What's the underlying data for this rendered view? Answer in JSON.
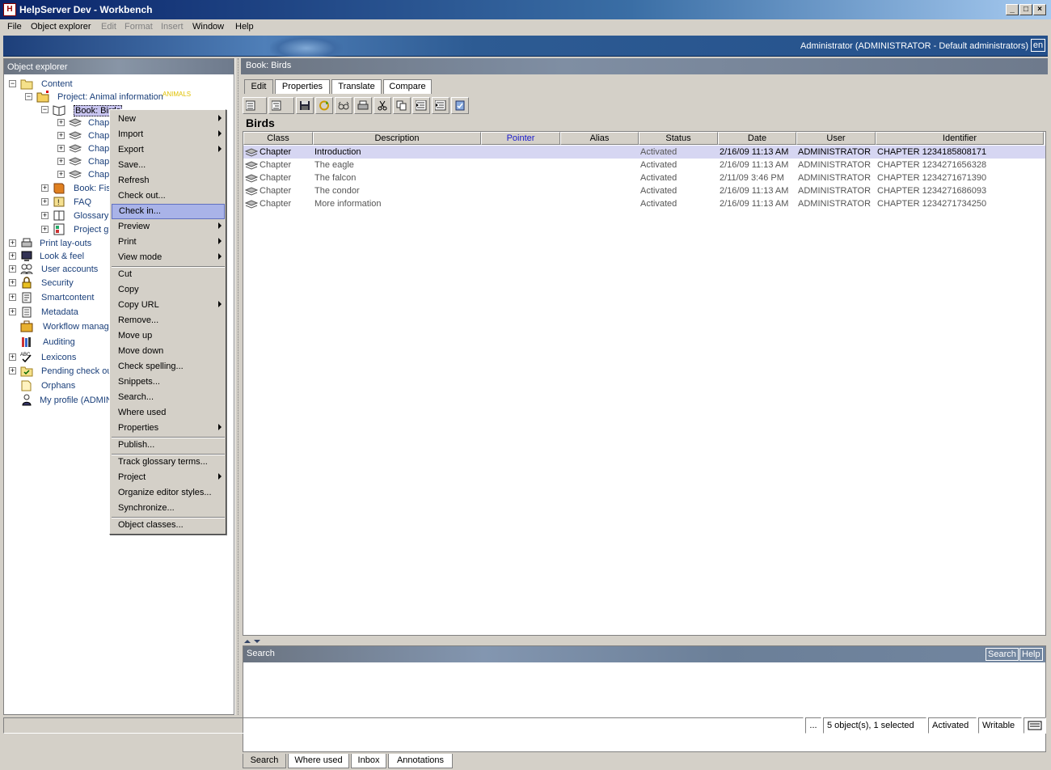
{
  "window": {
    "title": "HelpServer Dev - Workbench",
    "app_icon": "H"
  },
  "menubar": {
    "items": [
      {
        "label": "File",
        "enabled": true
      },
      {
        "label": "Object explorer",
        "enabled": true
      },
      {
        "label": "Edit",
        "enabled": false
      },
      {
        "label": "Format",
        "enabled": false
      },
      {
        "label": "Insert",
        "enabled": false
      },
      {
        "label": "Window",
        "enabled": true
      },
      {
        "label": "Help",
        "enabled": true
      }
    ]
  },
  "banner": {
    "user": "Administrator (ADMINISTRATOR - Default administrators)",
    "language": "en"
  },
  "explorer": {
    "title": "Object explorer",
    "tree": {
      "content": "Content",
      "project": "Project: Animal information",
      "project_tag": "ANIMALS",
      "book": "Book: Birds",
      "chapters": [
        "Chap",
        "Chap",
        "Chap",
        "Chap",
        "Chap"
      ],
      "book_fish": "Book: Fis",
      "faq": "FAQ",
      "glossary": "Glossary",
      "project_gl": "Project gl",
      "print_layouts": "Print lay-outs",
      "look_feel": "Look & feel",
      "user_accounts": "User accounts",
      "security": "Security",
      "smartcontent": "Smartcontent",
      "metadata": "Metadata",
      "workflow": "Workflow manag",
      "auditing": "Auditing",
      "lexicons": "Lexicons",
      "pending": "Pending check ou",
      "orphans": "Orphans",
      "my_profile": "My profile (ADMIN"
    }
  },
  "context_menu": {
    "items": [
      {
        "label": "New",
        "submenu": true
      },
      {
        "label": "Import",
        "submenu": true
      },
      {
        "label": "Export",
        "submenu": true
      },
      {
        "label": "Save...",
        "submenu": false
      },
      {
        "label": "Refresh",
        "submenu": false
      },
      {
        "label": "Check out...",
        "submenu": false
      },
      {
        "label": "Check in...",
        "submenu": false,
        "highlighted": true
      },
      {
        "label": "Preview",
        "submenu": true
      },
      {
        "label": "Print",
        "submenu": true
      },
      {
        "label": "View mode",
        "submenu": true
      },
      {
        "label": "Cut",
        "submenu": false
      },
      {
        "label": "Copy",
        "submenu": false
      },
      {
        "label": "Copy URL",
        "submenu": true
      },
      {
        "label": "Remove...",
        "submenu": false
      },
      {
        "label": "Move up",
        "submenu": false
      },
      {
        "label": "Move down",
        "submenu": false
      },
      {
        "label": "Check spelling...",
        "submenu": false
      },
      {
        "label": "Snippets...",
        "submenu": false
      },
      {
        "label": "Search...",
        "submenu": false
      },
      {
        "label": "Where used",
        "submenu": false
      },
      {
        "label": "Properties",
        "submenu": true
      },
      {
        "label": "Publish...",
        "submenu": false
      },
      {
        "label": "Track glossary terms...",
        "submenu": false
      },
      {
        "label": "Project",
        "submenu": true
      },
      {
        "label": "Organize editor styles...",
        "submenu": false
      },
      {
        "label": "Synchronize...",
        "submenu": false
      },
      {
        "label": "Object classes...",
        "submenu": false
      }
    ]
  },
  "main": {
    "header": "Book: Birds",
    "tabs": [
      "Edit",
      "Properties",
      "Translate",
      "Compare"
    ],
    "active_tab": "Edit",
    "doc_title": "Birds",
    "columns": [
      "Class",
      "Description",
      "Pointer",
      "Alias",
      "Status",
      "Date",
      "User",
      "Identifier"
    ],
    "rows": [
      {
        "class": "Chapter",
        "description": "Introduction",
        "pointer": "",
        "alias": "",
        "status": "Activated",
        "date": "2/16/09 11:13 AM",
        "user": "ADMINISTRATOR",
        "identifier": "CHAPTER 1234185808171",
        "selected": true
      },
      {
        "class": "Chapter",
        "description": "The eagle",
        "pointer": "",
        "alias": "",
        "status": "Activated",
        "date": "2/16/09 11:13 AM",
        "user": "ADMINISTRATOR",
        "identifier": "CHAPTER 1234271656328",
        "selected": false
      },
      {
        "class": "Chapter",
        "description": "The falcon",
        "pointer": "",
        "alias": "",
        "status": "Activated",
        "date": "2/11/09 3:46 PM",
        "user": "ADMINISTRATOR",
        "identifier": "CHAPTER 1234271671390",
        "selected": false
      },
      {
        "class": "Chapter",
        "description": "The condor",
        "pointer": "",
        "alias": "",
        "status": "Activated",
        "date": "2/16/09 11:13 AM",
        "user": "ADMINISTRATOR",
        "identifier": "CHAPTER 1234271686093",
        "selected": false
      },
      {
        "class": "Chapter",
        "description": "More information",
        "pointer": "",
        "alias": "",
        "status": "Activated",
        "date": "2/16/09 11:13 AM",
        "user": "ADMINISTRATOR",
        "identifier": "CHAPTER 1234271734250",
        "selected": false
      }
    ]
  },
  "search_panel": {
    "title": "Search",
    "search_button": "Search",
    "help_button": "Help",
    "bottom_tabs": [
      "Search",
      "Where used",
      "Inbox",
      "Annotations"
    ],
    "active_bottom_tab": "Search"
  },
  "statusbar": {
    "ellipsis": "...",
    "selection": "5 object(s), 1 selected",
    "status": "Activated",
    "mode": "Writable"
  },
  "colors": {
    "title_bar": "#0a246a",
    "selection": "#c8c4f0",
    "menu_highlight": "#a9b3e8",
    "tag": "#e0c000"
  }
}
